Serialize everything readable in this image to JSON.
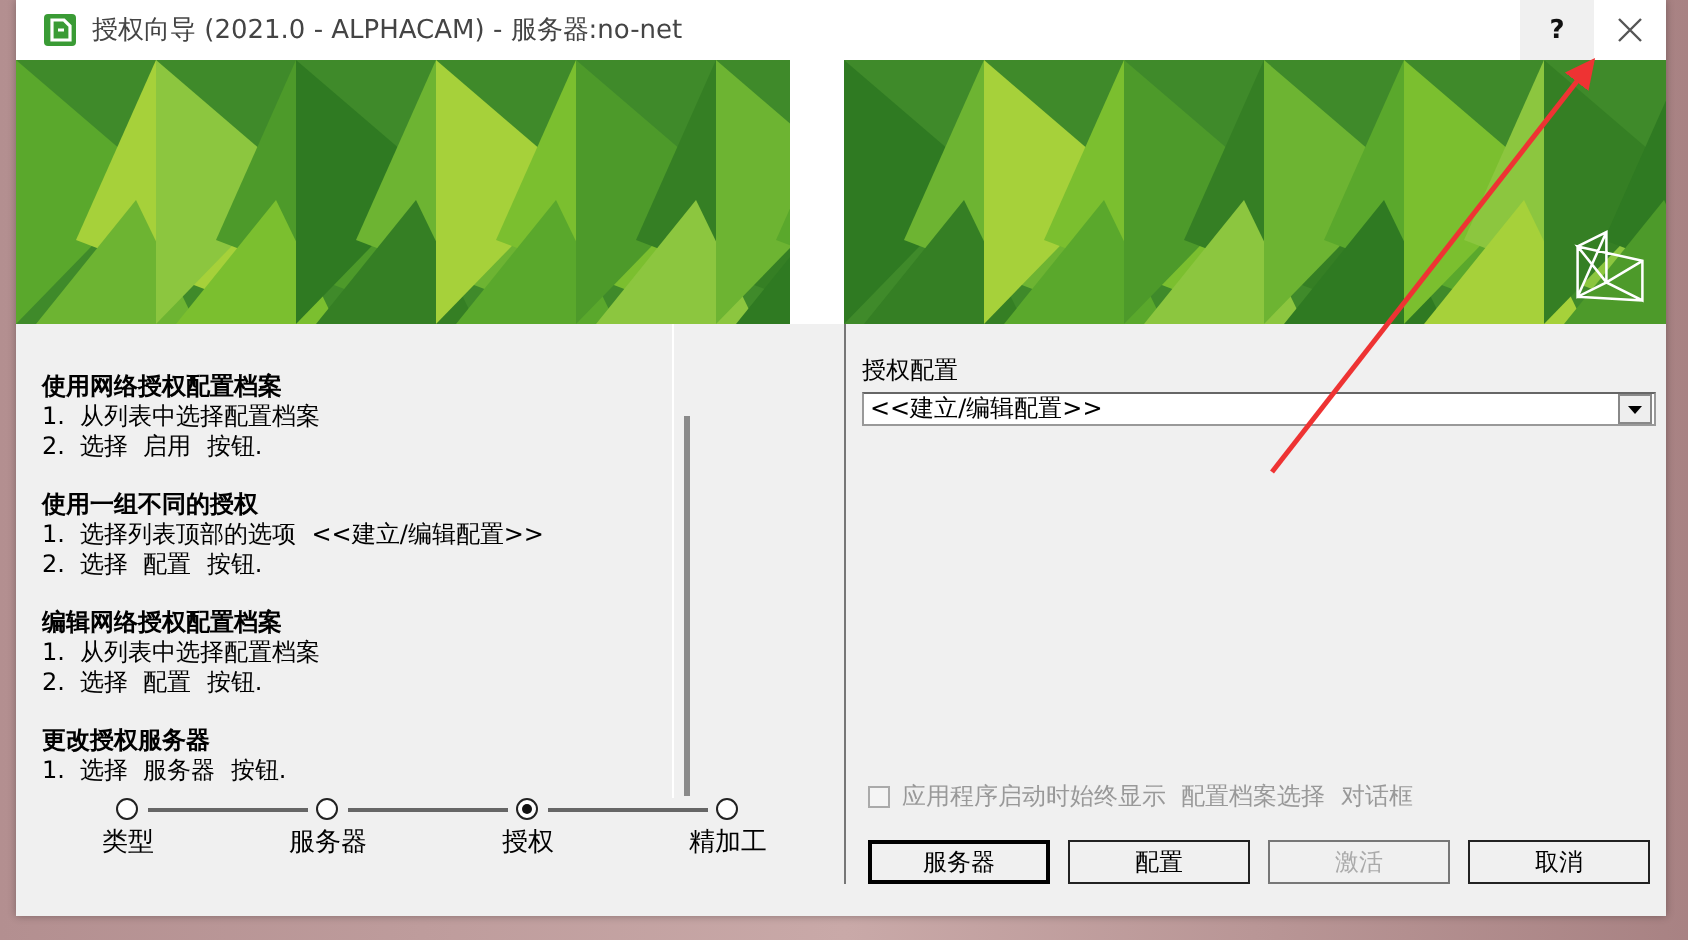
{
  "window": {
    "title": "授权向导 (2021.0 - ALPHACAM) - 服务器:no-net",
    "help_button": "?"
  },
  "instructions": [
    {
      "heading": "使用网络授权配置档案",
      "steps": [
        "1.  从列表中选择配置档案",
        "2.  选择  启用  按钮."
      ]
    },
    {
      "heading": "使用一组不同的授权",
      "steps": [
        "1.  选择列表顶部的选项  <<建立/编辑配置>>",
        "2.  选择  配置  按钮."
      ]
    },
    {
      "heading": "编辑网络授权配置档案",
      "steps": [
        "1.  从列表中选择配置档案",
        "2.  选择  配置  按钮."
      ]
    },
    {
      "heading": "更改授权服务器",
      "steps": [
        "1.  选择  服务器  按钮."
      ]
    }
  ],
  "wizard_steps": [
    {
      "label": "类型",
      "selected": false
    },
    {
      "label": "服务器",
      "selected": false
    },
    {
      "label": "授权",
      "selected": true
    },
    {
      "label": "精加工",
      "selected": false
    }
  ],
  "license_config": {
    "label": "授权配置",
    "value": "<<建立/编辑配置>>"
  },
  "startup_checkbox": {
    "label": "应用程序启动时始终显示  配置档案选择  对话框",
    "checked": false,
    "disabled": true
  },
  "buttons": [
    {
      "label": "服务器",
      "default": true,
      "disabled": false
    },
    {
      "label": "配置",
      "default": false,
      "disabled": false
    },
    {
      "label": "激活",
      "default": false,
      "disabled": true
    },
    {
      "label": "取消",
      "default": false,
      "disabled": false
    }
  ]
}
